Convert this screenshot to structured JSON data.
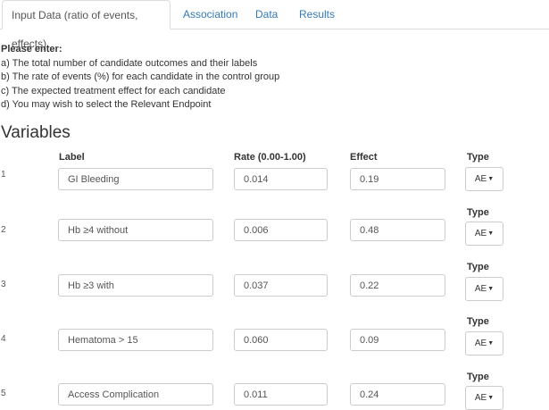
{
  "tabs": [
    {
      "label": "Input Data (ratio of events, effects)",
      "active": true
    },
    {
      "label": "Association",
      "active": false
    },
    {
      "label": "Data",
      "active": false
    },
    {
      "label": "Results",
      "active": false
    }
  ],
  "intro": {
    "heading": "Please enter:",
    "lines": [
      "a) The total number of candidate outcomes and their labels",
      "b) The rate of events (%) for each candidate in the control group",
      "c) The expected treatment effect for each candidate",
      "d) You may wish to select the Relevant Endpoint"
    ]
  },
  "section_title": "Variables",
  "columns": {
    "label": "Label",
    "rate": "Rate (0.00-1.00)",
    "effect": "Effect",
    "type": "Type"
  },
  "type_button": {
    "label": "AE",
    "icon": "caret-down-icon"
  },
  "rows": [
    {
      "num": "1",
      "label": "GI Bleeding",
      "rate": "0.014",
      "effect": "0.19"
    },
    {
      "num": "2",
      "label": "Hb ≥4 without",
      "rate": "0.006",
      "effect": "0.48"
    },
    {
      "num": "3",
      "label": "Hb ≥3 with",
      "rate": "0.037",
      "effect": "0.22"
    },
    {
      "num": "4",
      "label": "Hematoma > 15",
      "rate": "0.060",
      "effect": "0.09"
    },
    {
      "num": "5",
      "label": "Access Complication",
      "rate": "0.011",
      "effect": "0.24"
    }
  ]
}
